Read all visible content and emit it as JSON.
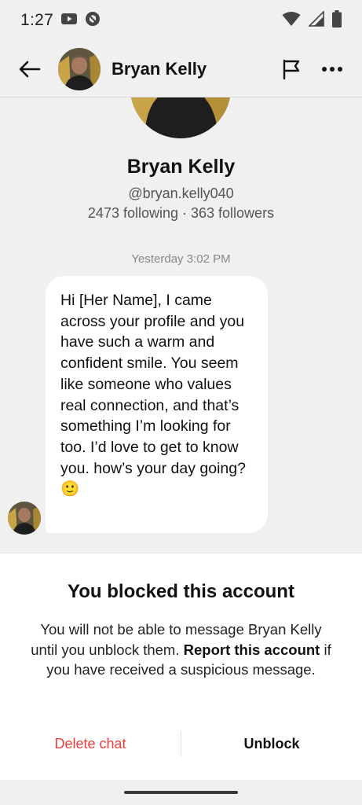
{
  "status_bar": {
    "time": "1:27",
    "left_icons": [
      "youtube-icon",
      "no-sync-icon"
    ],
    "right_icons": [
      "wifi-icon",
      "cellular-icon",
      "battery-icon"
    ]
  },
  "header": {
    "back_icon": "back-arrow-icon",
    "name": "Bryan Kelly",
    "flag_icon": "flag-icon",
    "more_icon": "more-options-icon"
  },
  "profile": {
    "name": "Bryan Kelly",
    "handle": "@bryan.kelly040",
    "stats": "2473 following · 363 followers"
  },
  "conversation": {
    "timestamp": "Yesterday 3:02 PM",
    "message": "Hi [Her Name], I came across your profile and you have such a warm and confident smile. You seem like someone who values real connection, and that’s something I’m looking for too. I’d love to get to know you. how’s your day going? 🙂"
  },
  "blocked_panel": {
    "title": "You blocked this account",
    "desc_part1": "You will not be able to message Bryan Kelly until you unblock them. ",
    "desc_bold": "Report this account",
    "desc_part2": " if you have received a suspicious message.",
    "delete_label": "Delete chat",
    "unblock_label": "Unblock"
  },
  "colors": {
    "background": "#f0f0f1",
    "panel": "#ffffff",
    "danger": "#ee3b3b",
    "muted": "#555555"
  }
}
